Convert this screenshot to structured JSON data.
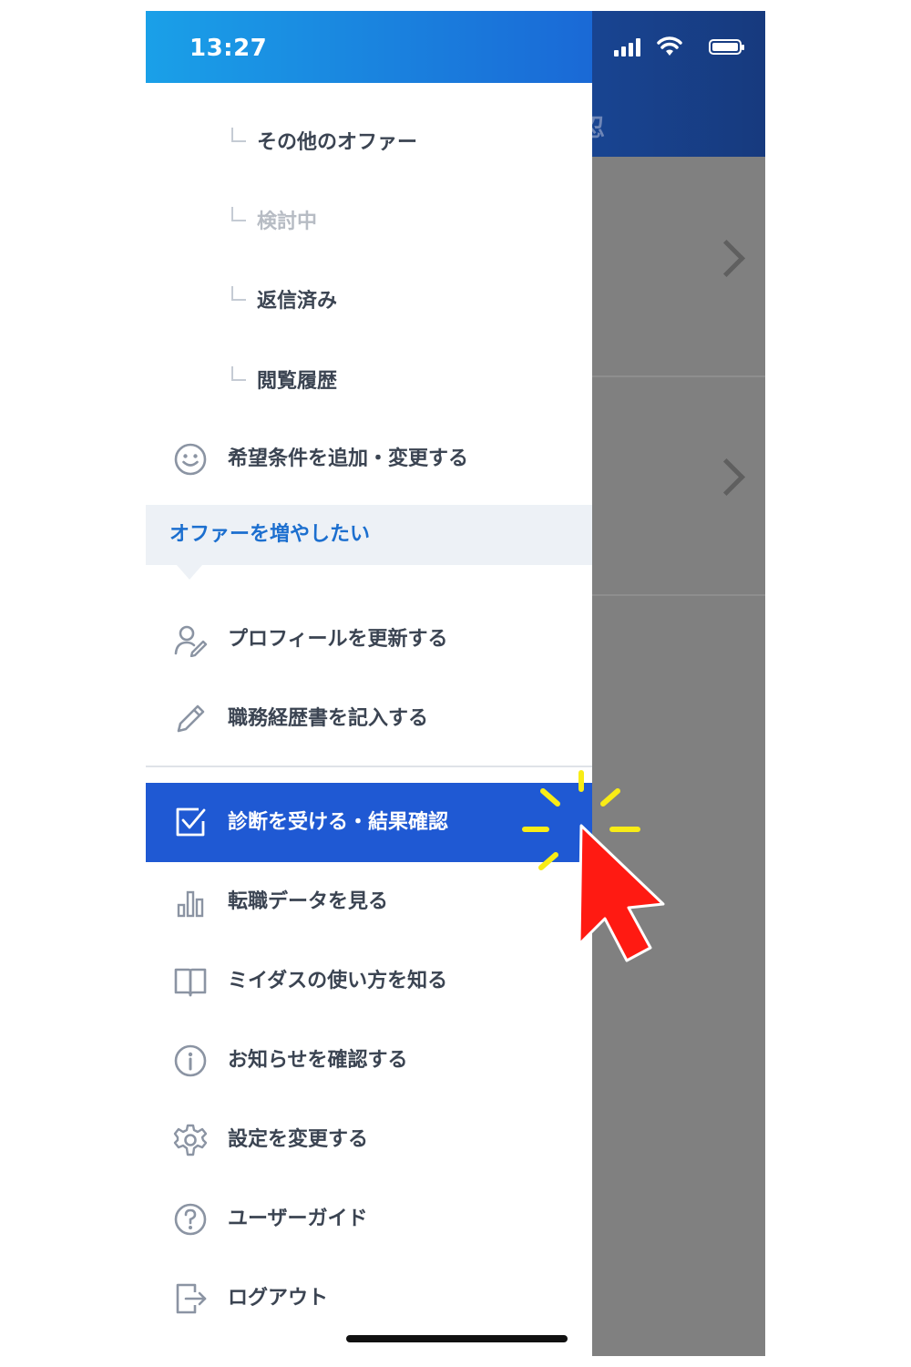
{
  "status_bar": {
    "time": "13:27"
  },
  "background_app": {
    "header_fragment": "忍"
  },
  "drawer": {
    "sub_items": [
      {
        "label": "その他のオファー",
        "muted": false
      },
      {
        "label": "検討中",
        "muted": true
      },
      {
        "label": "返信済み",
        "muted": false
      },
      {
        "label": "閲覧履歴",
        "muted": false
      }
    ],
    "preferences_item": {
      "label": "希望条件を追加・変更する",
      "icon": "smiley-icon"
    },
    "section_header": "オファーを増やしたい",
    "profile_items": [
      {
        "label": "プロフィールを更新する",
        "icon": "profile-edit-icon"
      },
      {
        "label": "職務経歴書を記入する",
        "icon": "pencil-icon"
      }
    ],
    "menu_items": [
      {
        "label": "診断を受ける・結果確認",
        "icon": "checkbox-icon",
        "active": true
      },
      {
        "label": "転職データを見る",
        "icon": "bar-chart-icon",
        "active": false
      },
      {
        "label": "ミイダスの使い方を知る",
        "icon": "book-icon",
        "active": false
      },
      {
        "label": "お知らせを確認する",
        "icon": "info-icon",
        "active": false
      },
      {
        "label": "設定を変更する",
        "icon": "gear-icon",
        "active": false
      },
      {
        "label": "ユーザーガイド",
        "icon": "help-icon",
        "active": false
      },
      {
        "label": "ログアウト",
        "icon": "logout-icon",
        "active": false
      }
    ]
  },
  "colors": {
    "status_gradient_start": "#1aa0e8",
    "active_item": "#1f59d3",
    "section_text": "#1c6fcf",
    "pointer": "#ff1a12",
    "click_burst": "#f8ec16"
  }
}
